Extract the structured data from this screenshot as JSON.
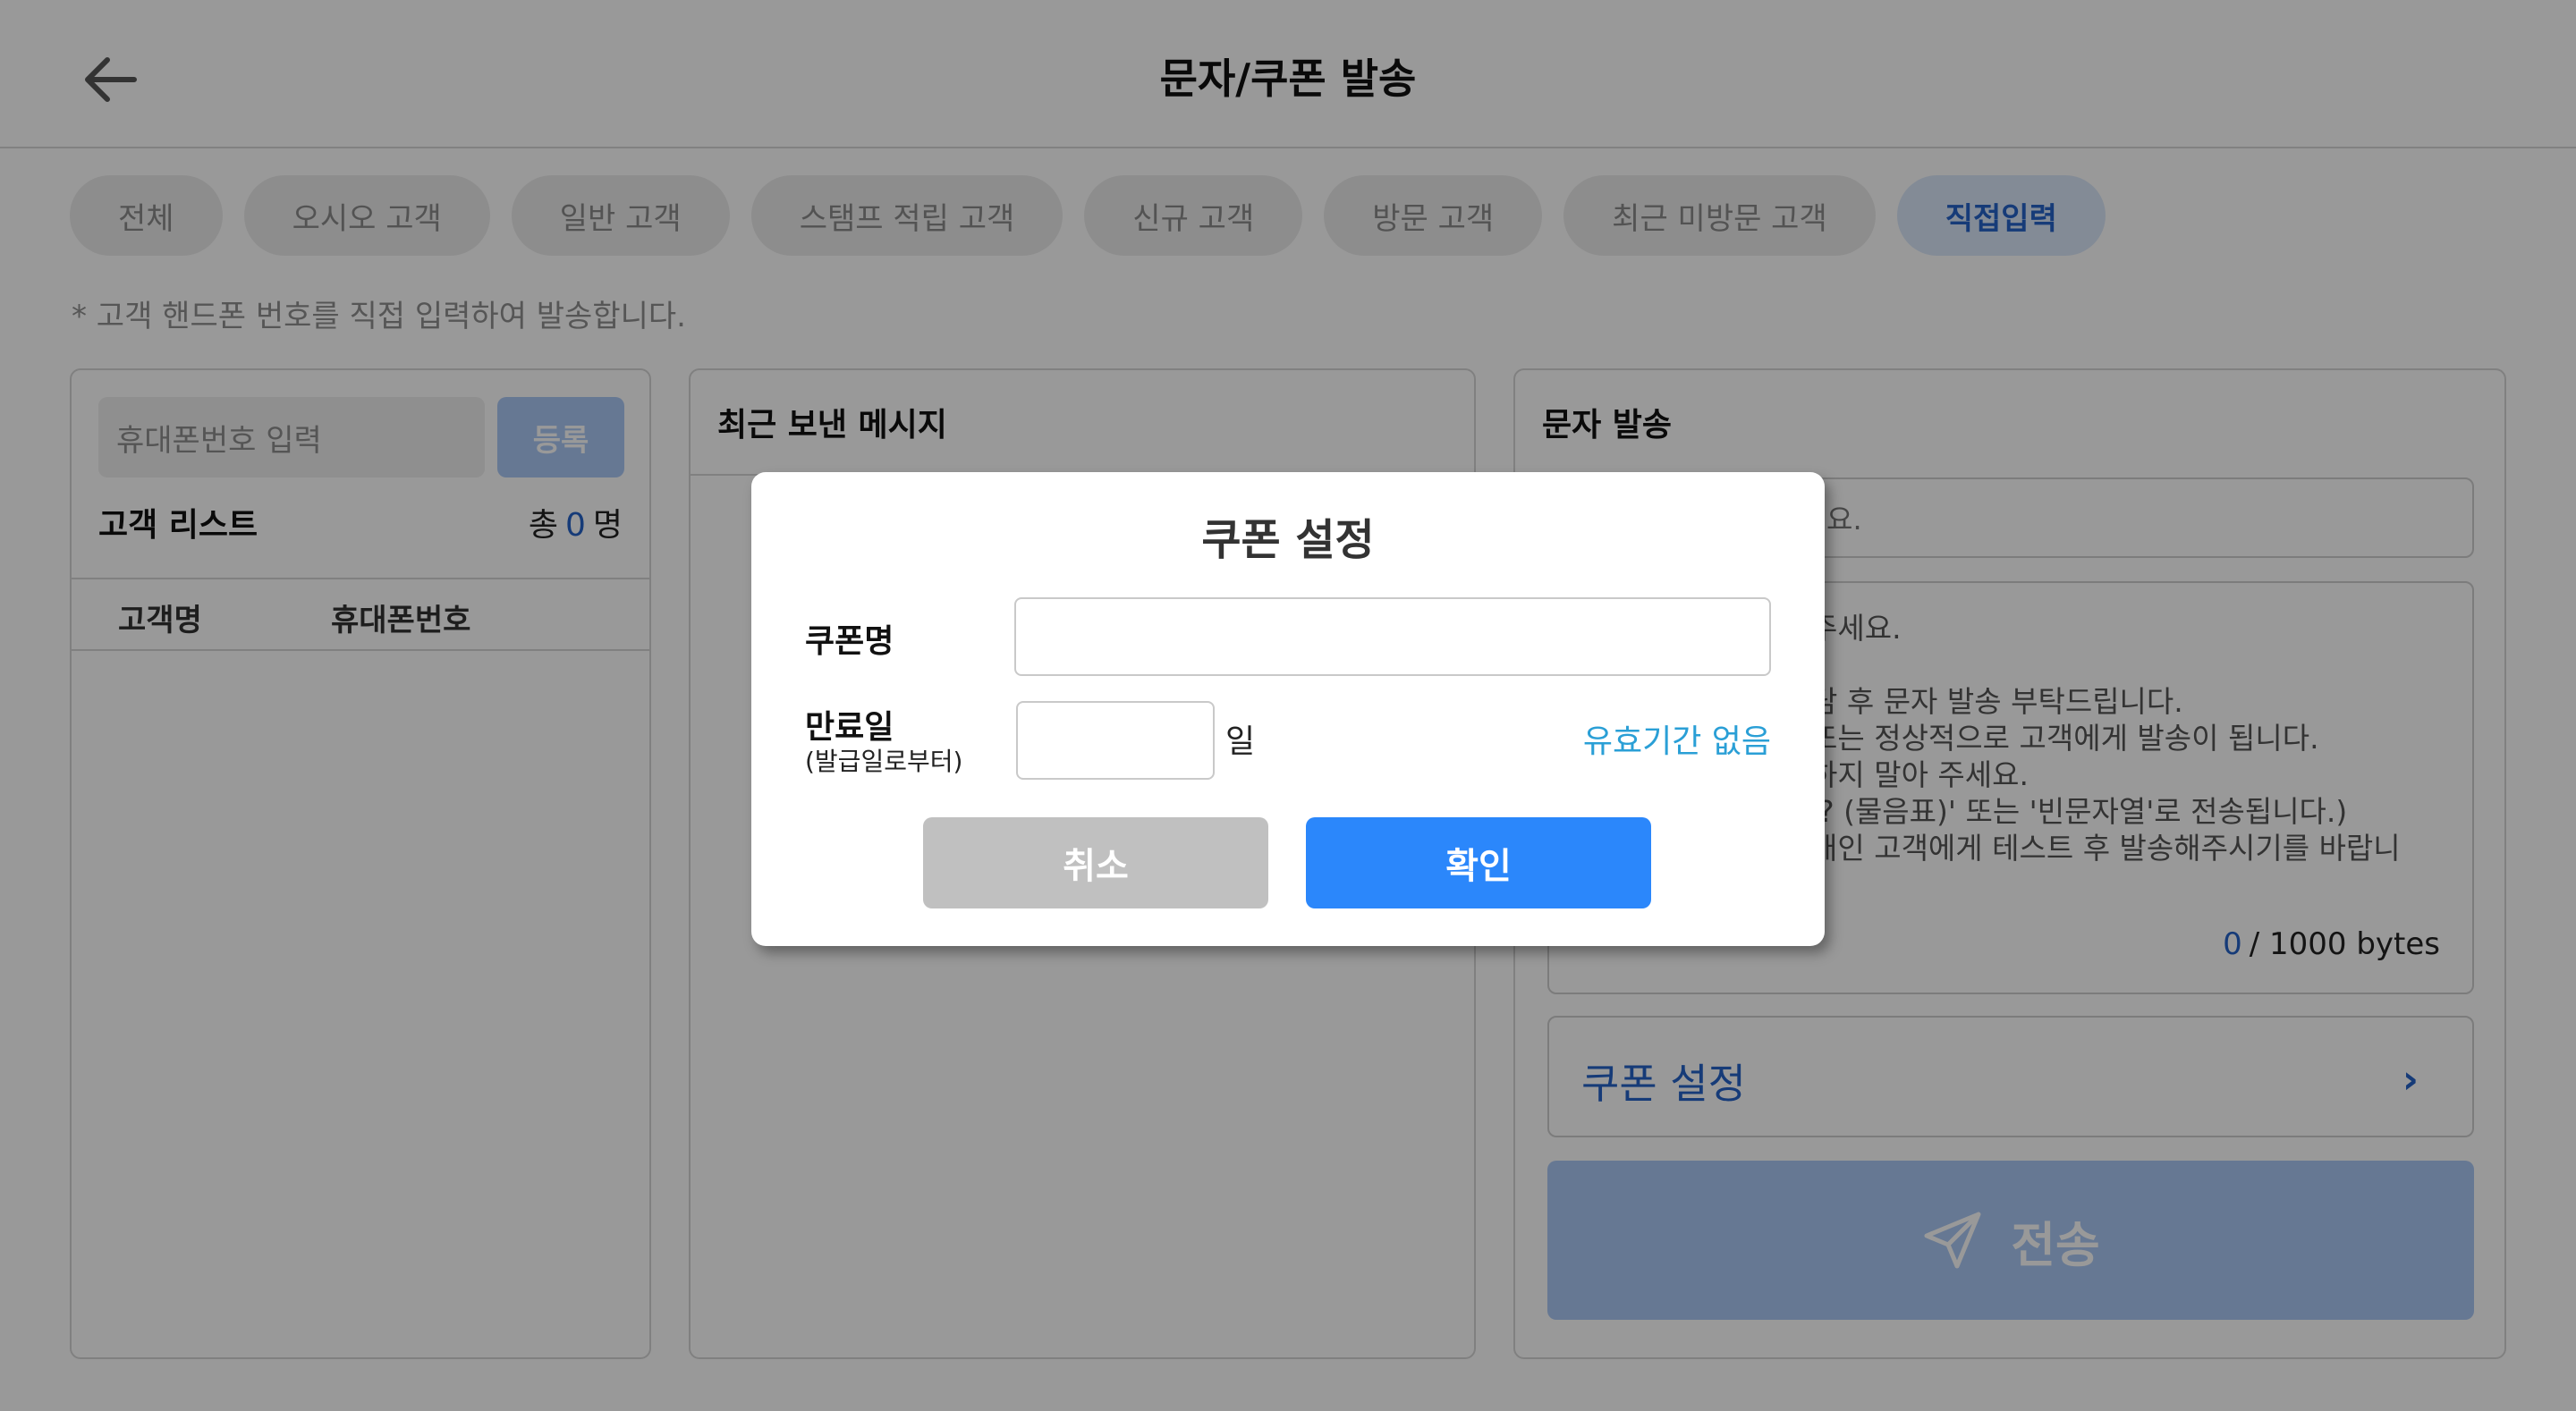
{
  "header": {
    "title": "문자/쿠폰 발송"
  },
  "filters": [
    {
      "label": "전체"
    },
    {
      "label": "오시오 고객"
    },
    {
      "label": "일반 고객"
    },
    {
      "label": "스탬프 적립 고객"
    },
    {
      "label": "신규 고객"
    },
    {
      "label": "방문 고객"
    },
    {
      "label": "최근 미방문 고객"
    },
    {
      "label": "직접입력",
      "active": true
    }
  ],
  "hint": "* 고객 핸드폰 번호를 직접 입력하여 발송합니다.",
  "customer_panel": {
    "phone_placeholder": "휴대폰번호 입력",
    "register_label": "등록",
    "list_title": "고객 리스트",
    "total_prefix": "총",
    "total_count": "0",
    "total_suffix": "명",
    "columns": [
      "고객명",
      "휴대폰번호"
    ]
  },
  "recent_panel": {
    "title": "최근 보낸 메시지"
  },
  "message_panel": {
    "title": "문자 발송",
    "title_input_visible": "요.",
    "message_visible": "주세요.\n\n담 후 문자 발송 부탁드립니다.\n또는 정상적으로 고객에게 발송이 됩니다.\n하지 말아 주세요.\n'? (물음표)' 또는 '빈문자열'로 전송됩니다.)\n개인 고객에게 테스트 후 발송해주시기를 바랍니",
    "byte_count": "0",
    "byte_limit": "/ 1000 bytes",
    "coupon_label": "쿠폰 설정",
    "coupon_chevron": "›",
    "send_label": "전송"
  },
  "modal": {
    "title": "쿠폰 설정",
    "coupon_name_label": "쿠폰명",
    "coupon_name_value": "",
    "expiry_label": "만료일",
    "expiry_sub": "(발급일로부터)",
    "expiry_days_value": "",
    "expiry_unit": "일",
    "no_expiry_label": "유효기간 없음",
    "cancel_label": "취소",
    "ok_label": "확인"
  },
  "colors": {
    "accent": "#2b87fb",
    "link": "#2a9fd6",
    "disabled_button": "#aac8f5",
    "cancel_button": "#c0c0c0",
    "overlay": "rgba(0,0,0,0.4)"
  }
}
